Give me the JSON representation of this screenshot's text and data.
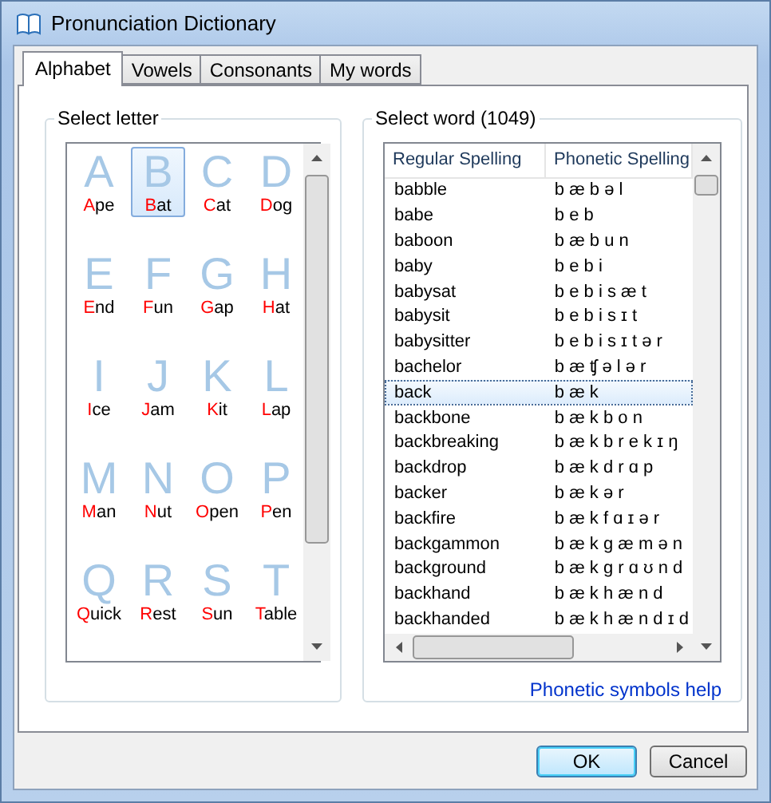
{
  "window": {
    "title": "Pronunciation Dictionary"
  },
  "tabs": [
    {
      "label": "Alphabet",
      "selected": true
    },
    {
      "label": "Vowels",
      "selected": false
    },
    {
      "label": "Consonants",
      "selected": false
    },
    {
      "label": "My words",
      "selected": false
    }
  ],
  "letter_group": {
    "label": "Select letter",
    "letters": [
      {
        "letter": "A",
        "word": "Ape",
        "selected": false
      },
      {
        "letter": "B",
        "word": "Bat",
        "selected": true
      },
      {
        "letter": "C",
        "word": "Cat",
        "selected": false
      },
      {
        "letter": "D",
        "word": "Dog",
        "selected": false
      },
      {
        "letter": "E",
        "word": "End",
        "selected": false
      },
      {
        "letter": "F",
        "word": "Fun",
        "selected": false
      },
      {
        "letter": "G",
        "word": "Gap",
        "selected": false
      },
      {
        "letter": "H",
        "word": "Hat",
        "selected": false
      },
      {
        "letter": "I",
        "word": "Ice",
        "selected": false
      },
      {
        "letter": "J",
        "word": "Jam",
        "selected": false
      },
      {
        "letter": "K",
        "word": "Kit",
        "selected": false
      },
      {
        "letter": "L",
        "word": "Lap",
        "selected": false
      },
      {
        "letter": "M",
        "word": "Man",
        "selected": false
      },
      {
        "letter": "N",
        "word": "Nut",
        "selected": false
      },
      {
        "letter": "O",
        "word": "Open",
        "selected": false
      },
      {
        "letter": "P",
        "word": "Pen",
        "selected": false
      },
      {
        "letter": "Q",
        "word": "Quick",
        "selected": false
      },
      {
        "letter": "R",
        "word": "Rest",
        "selected": false
      },
      {
        "letter": "S",
        "word": "Sun",
        "selected": false
      },
      {
        "letter": "T",
        "word": "Table",
        "selected": false
      }
    ]
  },
  "word_group": {
    "label": "Select word (1049)",
    "columns": [
      "Regular Spelling",
      "Phonetic Spelling"
    ],
    "rows": [
      {
        "regular": "babble",
        "phonetic": "b æ b ə l",
        "selected": false
      },
      {
        "regular": "babe",
        "phonetic": "b e b",
        "selected": false
      },
      {
        "regular": "baboon",
        "phonetic": "b æ b u n",
        "selected": false
      },
      {
        "regular": "baby",
        "phonetic": "b e b i",
        "selected": false
      },
      {
        "regular": "babysat",
        "phonetic": "b e b i s æ t",
        "selected": false
      },
      {
        "regular": "babysit",
        "phonetic": "b e b i s ɪ t",
        "selected": false
      },
      {
        "regular": "babysitter",
        "phonetic": "b e b i s ɪ t ə r",
        "selected": false
      },
      {
        "regular": "bachelor",
        "phonetic": "b æ ʧ ə l ə r",
        "selected": false
      },
      {
        "regular": "back",
        "phonetic": "b æ k",
        "selected": true
      },
      {
        "regular": "backbone",
        "phonetic": "b æ k b o n",
        "selected": false
      },
      {
        "regular": "backbreaking",
        "phonetic": "b æ k b r e k ɪ ŋ",
        "selected": false
      },
      {
        "regular": "backdrop",
        "phonetic": "b æ k d r ɑ p",
        "selected": false
      },
      {
        "regular": "backer",
        "phonetic": "b æ k ə r",
        "selected": false
      },
      {
        "regular": "backfire",
        "phonetic": "b æ k f ɑ ɪ ə r",
        "selected": false
      },
      {
        "regular": "backgammon",
        "phonetic": "b æ k g æ m ə n",
        "selected": false
      },
      {
        "regular": "background",
        "phonetic": "b æ k g r ɑ ʊ n d",
        "selected": false
      },
      {
        "regular": "backhand",
        "phonetic": "b æ k h æ n d",
        "selected": false
      },
      {
        "regular": "backhanded",
        "phonetic": "b æ k h æ n d ɪ d",
        "selected": false
      }
    ],
    "link": "Phonetic symbols help"
  },
  "buttons": [
    {
      "label": "OK",
      "kind": "default"
    },
    {
      "label": "Cancel",
      "kind": "normal"
    }
  ]
}
